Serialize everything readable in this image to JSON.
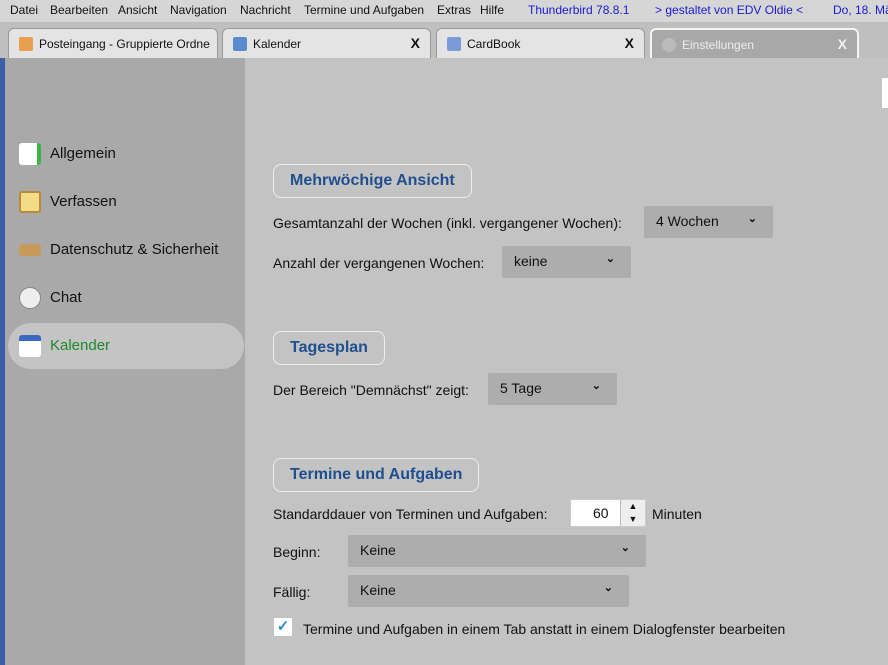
{
  "menubar": {
    "items": [
      "Datei",
      "Bearbeiten",
      "Ansicht",
      "Navigation",
      "Nachricht",
      "Termine und Aufgaben",
      "Extras",
      "Hilfe"
    ],
    "version": "Thunderbird 78.8.1",
    "credit": "> gestaltet von EDV Oldie <",
    "date": "Do, 18. Mä"
  },
  "tabs": [
    {
      "label": "Posteingang - Gruppierte Ordne"
    },
    {
      "label": "Kalender",
      "close": "X"
    },
    {
      "label": "CardBook",
      "close": "X"
    },
    {
      "label": "Einstellungen",
      "close": "X"
    }
  ],
  "sidebar": {
    "items": [
      {
        "label": "Allgemein"
      },
      {
        "label": "Verfassen"
      },
      {
        "label": "Datenschutz & Sicherheit"
      },
      {
        "label": "Chat"
      },
      {
        "label": "Kalender"
      }
    ]
  },
  "main": {
    "multiweek": {
      "title": "Mehrwöchige Ansicht",
      "total_label": "Gesamtanzahl der Wochen (inkl. vergangener Wochen):",
      "total_value": "4 Wochen",
      "past_label": "Anzahl der vergangenen Wochen:",
      "past_value": "keine"
    },
    "dayplan": {
      "title": "Tagesplan",
      "soon_label": "Der Bereich \"Demnächst\" zeigt:",
      "soon_value": "5 Tage"
    },
    "events": {
      "title": "Termine und Aufgaben",
      "duration_label": "Standarddauer von Terminen und Aufgaben:",
      "duration_value": "60",
      "duration_unit": "Minuten",
      "start_label": "Beginn:",
      "start_value": "Keine",
      "due_label": "Fällig:",
      "due_value": "Keine",
      "tab_checkbox_label": "Termine und Aufgaben in einem Tab anstatt in einem Dialogfenster bearbeiten",
      "tab_checkbox_checked": true
    }
  }
}
